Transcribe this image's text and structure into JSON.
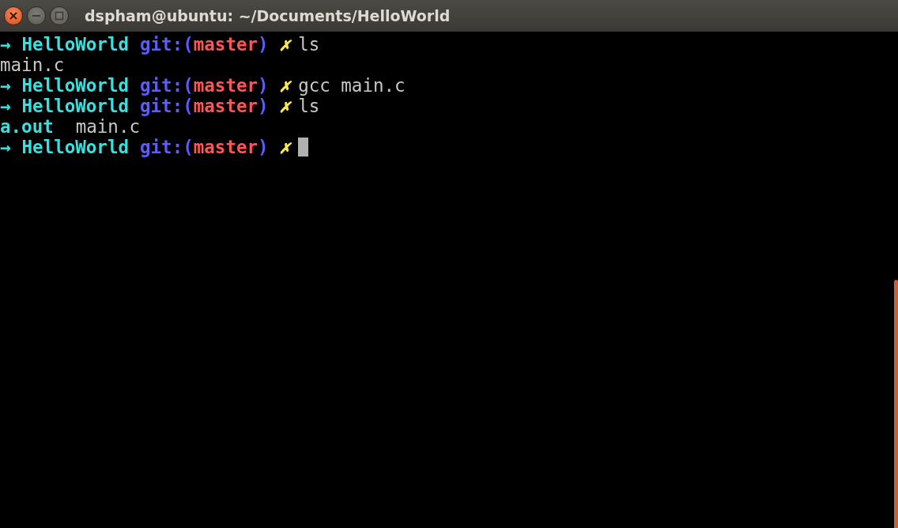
{
  "window": {
    "title": "dspham@ubuntu: ~/Documents/HelloWorld"
  },
  "lines": [
    {
      "kind": "prompt",
      "arrow": "→",
      "dir": "HelloWorld",
      "git_open": "git:(",
      "branch": "master",
      "git_close": ")",
      "dirty": "✗",
      "command": "ls",
      "cursor": false
    },
    {
      "kind": "output",
      "items": [
        {
          "text": "main.c",
          "kind": "file"
        }
      ]
    },
    {
      "kind": "prompt",
      "arrow": "→",
      "dir": "HelloWorld",
      "git_open": "git:(",
      "branch": "master",
      "git_close": ")",
      "dirty": "✗",
      "command": "gcc main.c",
      "cursor": false
    },
    {
      "kind": "prompt",
      "arrow": "→",
      "dir": "HelloWorld",
      "git_open": "git:(",
      "branch": "master",
      "git_close": ")",
      "dirty": "✗",
      "command": "ls",
      "cursor": false
    },
    {
      "kind": "output",
      "items": [
        {
          "text": "a.out",
          "kind": "executable"
        },
        {
          "text": "main.c",
          "kind": "file"
        }
      ]
    },
    {
      "kind": "prompt",
      "arrow": "→",
      "dir": "HelloWorld",
      "git_open": "git:(",
      "branch": "master",
      "git_close": ")",
      "dirty": "✗",
      "cursor": true
    }
  ]
}
